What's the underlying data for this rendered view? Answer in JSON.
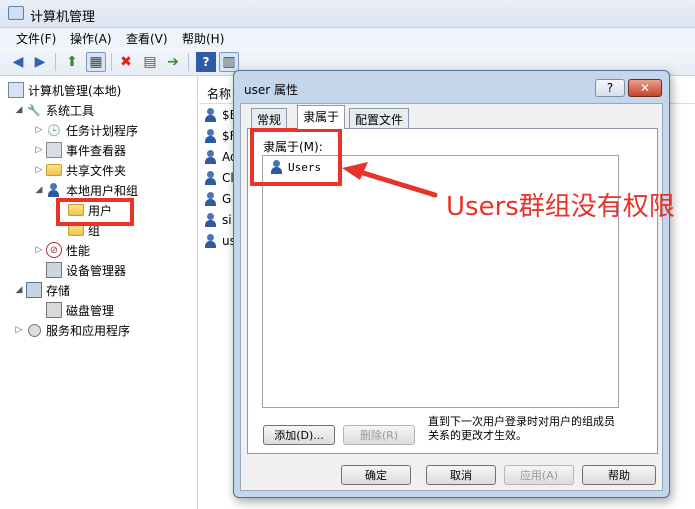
{
  "window": {
    "title": "计算机管理"
  },
  "menu": [
    "文件(F)",
    "操作(A)",
    "查看(V)",
    "帮助(H)"
  ],
  "toolbar": [
    "back-icon",
    "forward-icon",
    "up-icon",
    "show-hide-tree-icon",
    "delete-icon",
    "properties-icon",
    "export-icon",
    "help-icon",
    "view-icon"
  ],
  "tree": {
    "root": "计算机管理(本地)",
    "system_tools": "系统工具",
    "task_scheduler": "任务计划程序",
    "event_viewer": "事件查看器",
    "shared_folders": "共享文件夹",
    "local_users_groups": "本地用户和组",
    "users": "用户",
    "groups": "组",
    "performance": "性能",
    "device_manager": "设备管理器",
    "storage": "存储",
    "disk_management": "磁盘管理",
    "services_apps": "服务和应用程序"
  },
  "list": {
    "header": "名称",
    "rows": [
      "$E",
      "$F",
      "Ad",
      "Cl",
      "G",
      "si",
      "us"
    ]
  },
  "dialog": {
    "title": "user 属性",
    "help_btn": "?",
    "close_btn": "✕",
    "tabs": [
      "常规",
      "隶属于",
      "配置文件"
    ],
    "memberof_label": "隶属于(M):",
    "members": [
      "Users"
    ],
    "add_btn": "添加(D)...",
    "remove_btn": "删除(R)",
    "note": "直到下一次用户登录时对用户的组成员关系的更改才生效。",
    "ok_btn": "确定",
    "cancel_btn": "取消",
    "apply_btn": "应用(A)",
    "help_button": "帮助"
  },
  "annotation": {
    "text": "Users群组没有权限",
    "color": "#e8332a"
  }
}
